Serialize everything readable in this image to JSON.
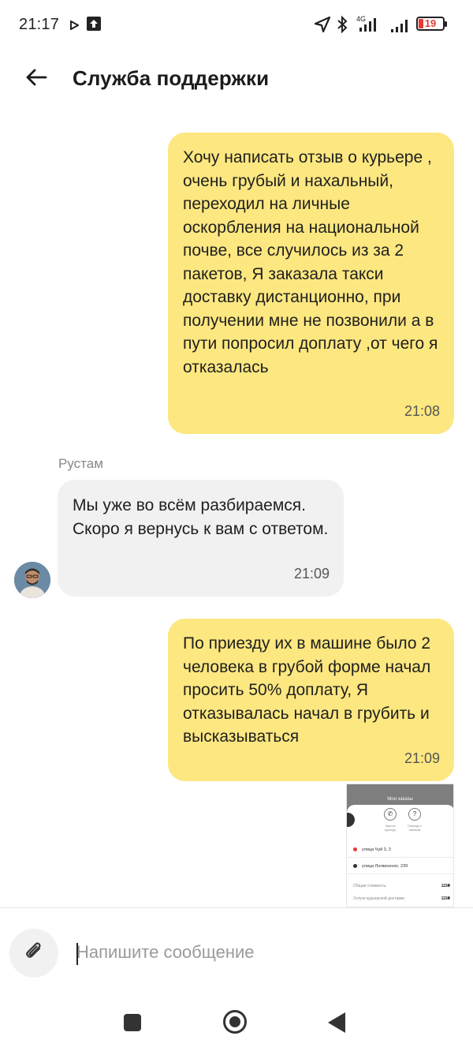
{
  "status_bar": {
    "time": "21:17",
    "network_label": "4G",
    "battery": "19"
  },
  "header": {
    "title": "Служба поддержки"
  },
  "messages": [
    {
      "direction": "outgoing",
      "text": "Хочу написать отзыв о курьере , очень грубый и нахальный, переходил на личные оскорбления на национальной почве, все случилось из за 2 пакетов, Я заказала такси доставку дистанционно, при получении мне не позвонили а в пути попросил доплату ,от чего я отказалась",
      "time": "21:08"
    },
    {
      "direction": "incoming",
      "sender": "Рустам",
      "text": "Мы уже во всём разбираемся. Скоро я вернусь к вам с ответом.",
      "time": "21:09"
    },
    {
      "direction": "outgoing",
      "text": "По приезду их в машине было 2 человека в грубой форме начал просить 50% доплату, Я отказывалась начал в грубить и высказываться",
      "time": "21:09"
    }
  ],
  "attachment": {
    "kind": "screenshot-thumbnail",
    "title": "Мои заказы",
    "caption_1": "Звонок курьеру",
    "caption_2": "Помощь с заказом",
    "address_1": "улица Чуй 3, 3",
    "address_2": "улица Логвиненко, 239",
    "price_label_1": "Общая стоимость",
    "price_value_1": "115₴",
    "price_label_2": "Услуги курьерской доставки",
    "price_value_2": "115₴"
  },
  "input": {
    "placeholder": "Напишите сообщение",
    "value": ""
  },
  "colors": {
    "outgoing_bubble": "#fde780",
    "incoming_bubble": "#f1f1f1",
    "battery_low": "#e53935"
  },
  "icons": {
    "back": "arrow-left-icon",
    "attach": "paperclip-icon",
    "nav_recents": "square-icon",
    "nav_home": "circle-icon",
    "nav_back": "triangle-back-icon"
  }
}
